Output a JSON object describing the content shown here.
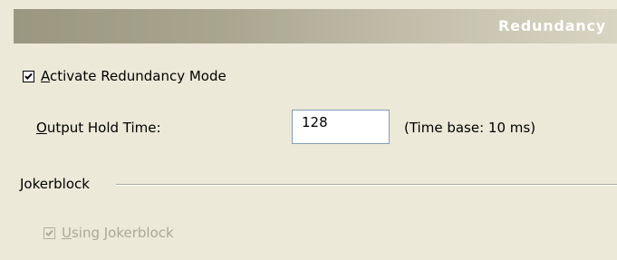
{
  "header": {
    "title": "Redundancy"
  },
  "activate_redundancy": {
    "hotkey": "A",
    "label_rest": "ctivate Redundancy Mode",
    "checked": true
  },
  "output_hold_time": {
    "hotkey": "O",
    "label_rest": "utput Hold Time:",
    "value": "128",
    "time_base": "(Time base: 10 ms)"
  },
  "jokerblock": {
    "group_label": "Jokerblock",
    "hotkey": "U",
    "label_rest": "sing Jokerblock",
    "checked": true,
    "enabled": false
  },
  "colors": {
    "background": "#ece9d8",
    "header_text": "#ffffff",
    "disabled_text": "#aca899",
    "input_border": "#7f9db9"
  }
}
